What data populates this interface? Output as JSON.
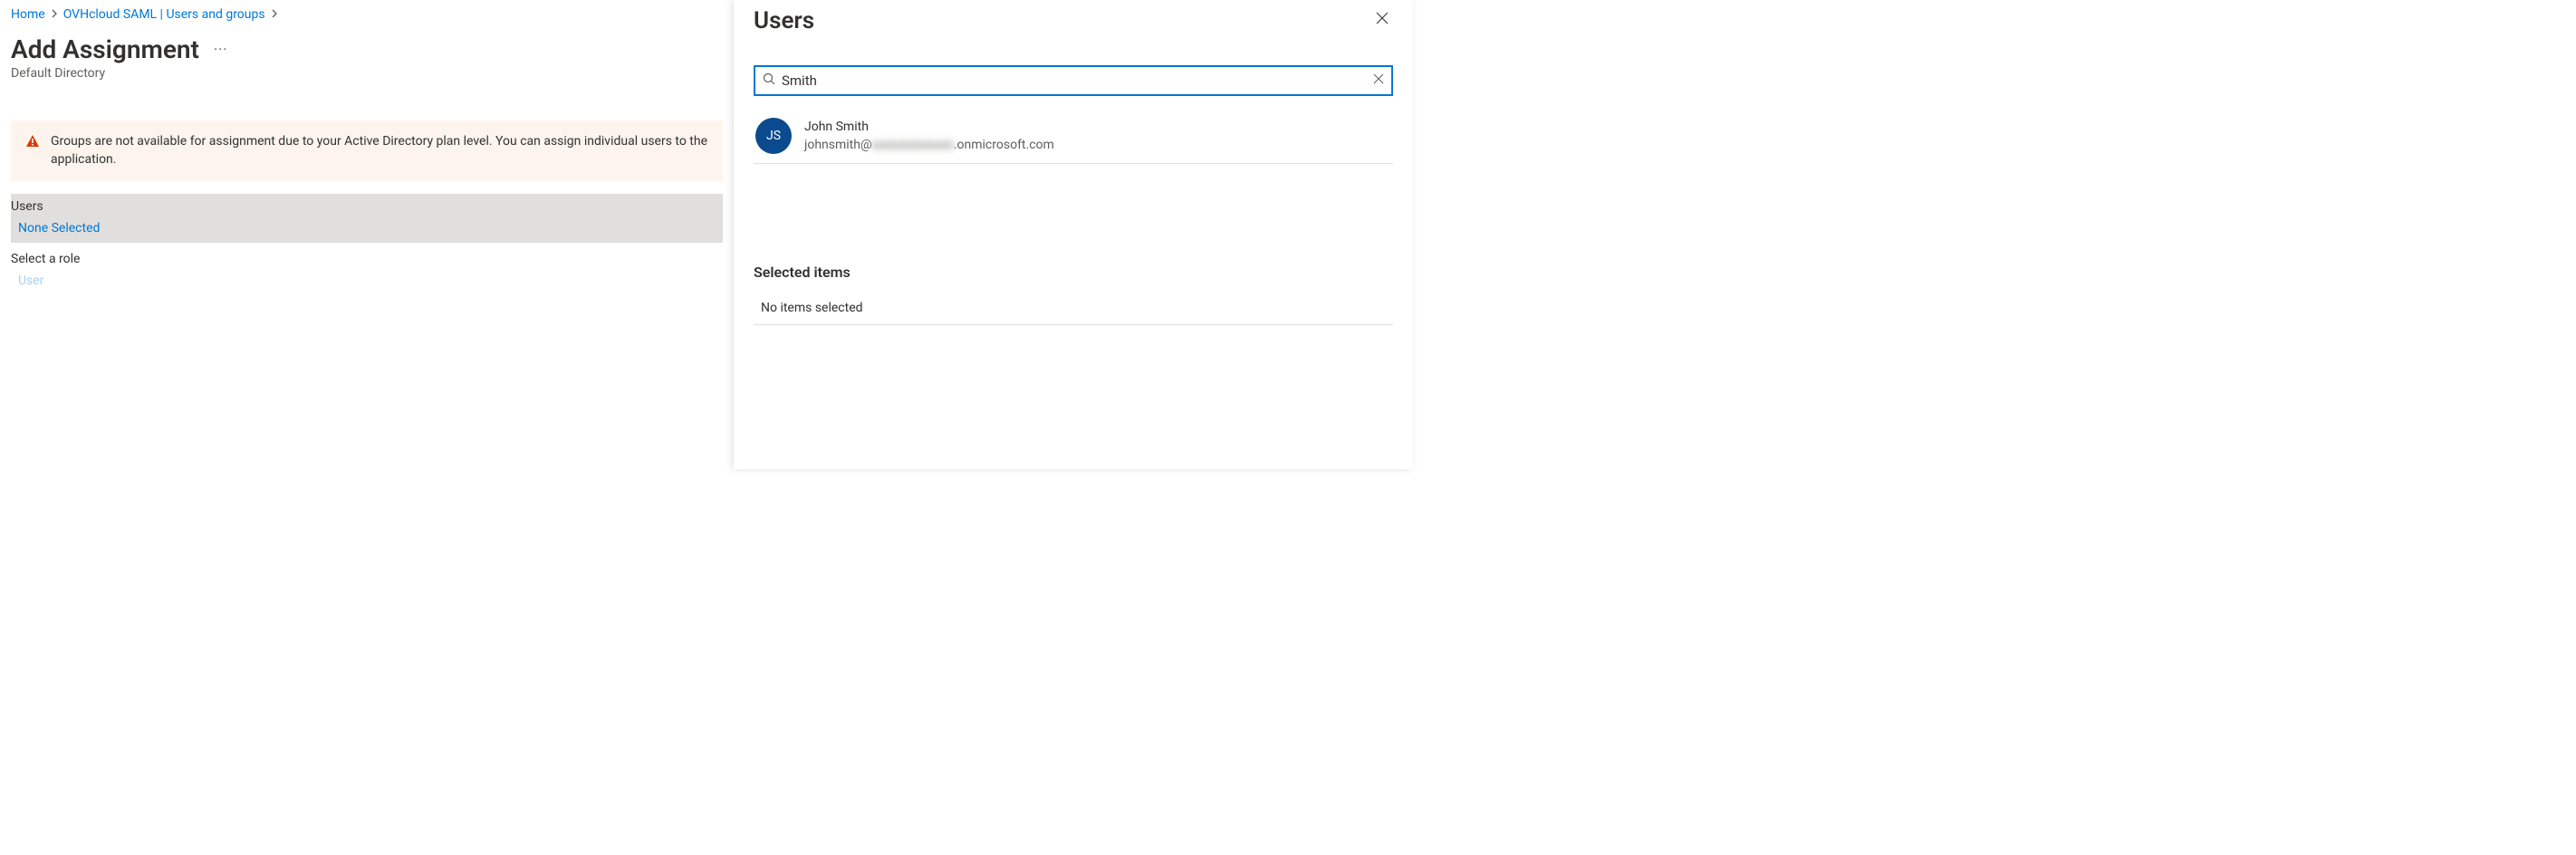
{
  "breadcrumb": {
    "home": "Home",
    "item2": "OVHcloud SAML | Users and groups"
  },
  "page": {
    "title": "Add Assignment",
    "subtitle": "Default Directory",
    "more": "···"
  },
  "warning": {
    "text": "Groups are not available for assignment due to your Active Directory plan level. You can assign individual users to the application."
  },
  "sections": {
    "users_label": "Users",
    "users_value": "None Selected",
    "role_label": "Select a role",
    "role_value": "User"
  },
  "panel": {
    "title": "Users",
    "search_value": "Smith",
    "result": {
      "initials": "JS",
      "name": "John Smith",
      "email_prefix": "johnsmith@",
      "email_hidden": "xxxxxxxxxxxxx",
      "email_suffix": ".onmicrosoft.com"
    },
    "selected_header": "Selected items",
    "no_items": "No items selected"
  }
}
